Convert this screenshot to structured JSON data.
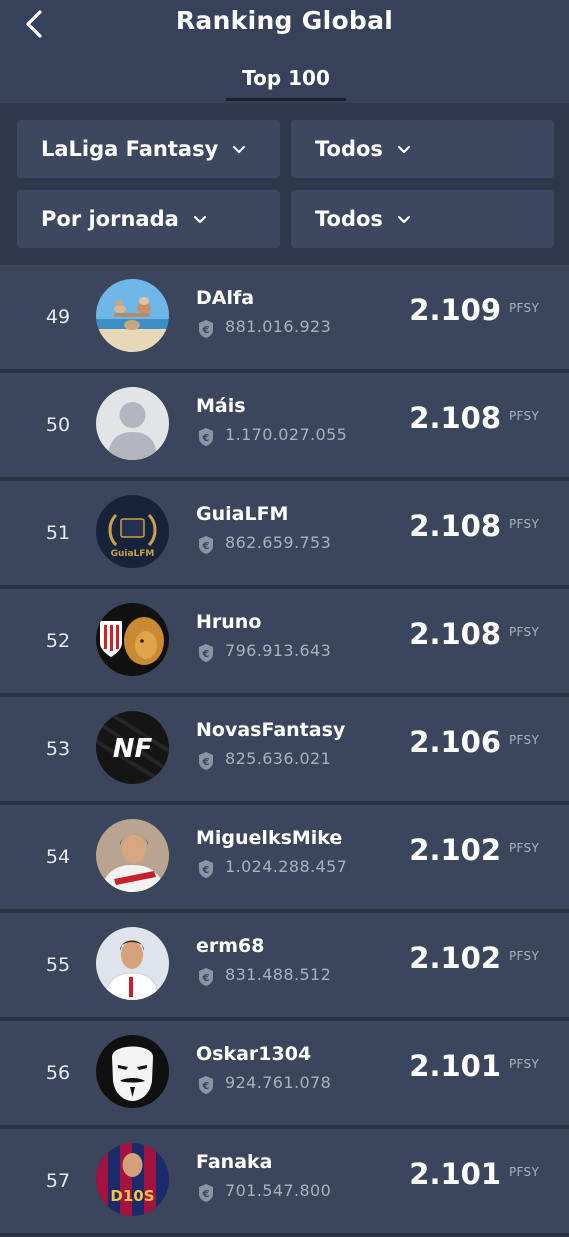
{
  "header": {
    "title": "Ranking Global",
    "tab": "Top 100"
  },
  "filters": {
    "competition": "LaLiga Fantasy",
    "type_filter": "Todos",
    "period": "Por jornada",
    "position_filter": "Todos"
  },
  "unit_label": "PFSY",
  "rows": [
    {
      "rank": "49",
      "name": "DAlfa",
      "value": "881.016.923",
      "points": "2.109",
      "avatar": "beach-stones"
    },
    {
      "rank": "50",
      "name": "Máis",
      "value": "1.170.027.055",
      "points": "2.108",
      "avatar": "default-user"
    },
    {
      "rank": "51",
      "name": "GuiaLFM",
      "value": "862.659.753",
      "points": "2.108",
      "avatar": "guialfm-badge"
    },
    {
      "rank": "52",
      "name": "Hruno",
      "value": "796.913.643",
      "points": "2.108",
      "avatar": "lion-crest"
    },
    {
      "rank": "53",
      "name": "NovasFantasy",
      "value": "825.636.021",
      "points": "2.106",
      "avatar": "nf-logo"
    },
    {
      "rank": "54",
      "name": "MiguelksMike",
      "value": "1.024.288.457",
      "points": "2.102",
      "avatar": "player-photo"
    },
    {
      "rank": "55",
      "name": "erm68",
      "value": "831.488.512",
      "points": "2.102",
      "avatar": "player-photo-white"
    },
    {
      "rank": "56",
      "name": "Oskar1304",
      "value": "924.761.078",
      "points": "2.101",
      "avatar": "mask"
    },
    {
      "rank": "57",
      "name": "Fanaka",
      "value": "701.547.800",
      "points": "2.101",
      "avatar": "player-dios"
    }
  ],
  "avatar_badge_texts": {
    "guialfm": "GuiaLFM",
    "nf": "NF",
    "dios": "D10S"
  }
}
